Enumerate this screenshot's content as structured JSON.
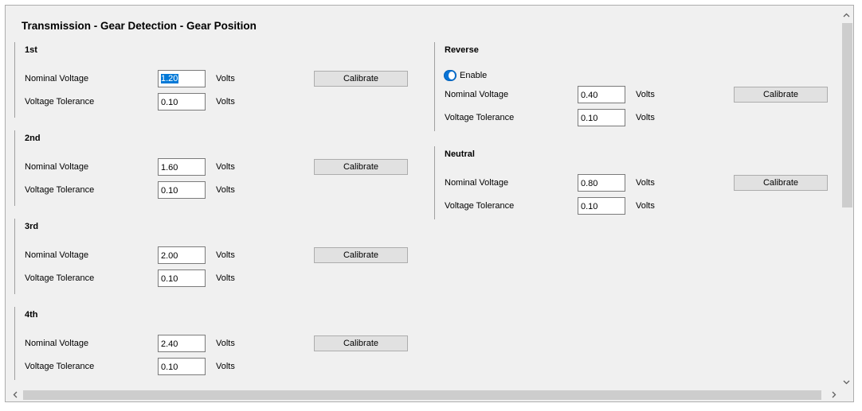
{
  "title": "Transmission - Gear Detection - Gear Position",
  "labels": {
    "nominal": "Nominal Voltage",
    "tolerance": "Voltage Tolerance",
    "unit": "Volts",
    "calibrate": "Calibrate",
    "enable": "Enable"
  },
  "gears": {
    "first": {
      "name": "1st",
      "nominal": "1.20",
      "tolerance": "0.10"
    },
    "second": {
      "name": "2nd",
      "nominal": "1.60",
      "tolerance": "0.10"
    },
    "third": {
      "name": "3rd",
      "nominal": "2.00",
      "tolerance": "0.10"
    },
    "fourth": {
      "name": "4th",
      "nominal": "2.40",
      "tolerance": "0.10"
    },
    "reverse": {
      "name": "Reverse",
      "nominal": "0.40",
      "tolerance": "0.10",
      "enabled": true
    },
    "neutral": {
      "name": "Neutral",
      "nominal": "0.80",
      "tolerance": "0.10"
    }
  },
  "icons": {
    "scroll_up": "chevron-up-icon",
    "scroll_down": "chevron-down-icon",
    "scroll_left": "chevron-left-icon",
    "scroll_right": "chevron-right-icon"
  },
  "colors": {
    "accent": "#0078d7",
    "panel": "#f0f0f0"
  }
}
